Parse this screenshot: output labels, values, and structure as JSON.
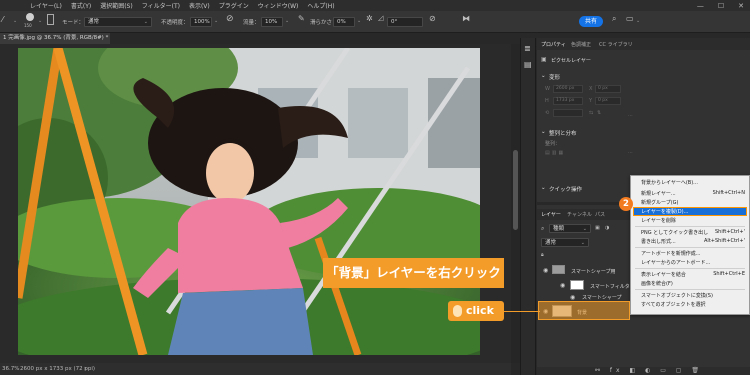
{
  "menubar": {
    "items": [
      "レイヤー(L)",
      "書式(Y)",
      "選択範囲(S)",
      "フィルター(T)",
      "表示(V)",
      "プラグイン",
      "ウィンドウ(W)",
      "ヘルプ(H)"
    ],
    "window_controls": [
      "—",
      "☐",
      "✕"
    ]
  },
  "options": {
    "brush_size": "150",
    "mode_label": "モード：",
    "mode_value": "通常",
    "opacity_label": "不透明度：",
    "opacity_value": "100%",
    "flow_label": "流量：",
    "flow_value": "10%",
    "smooth_label": "滑らかさ：",
    "smooth_value": "0%",
    "angle_value": "0°",
    "share_label": "共有"
  },
  "document": {
    "tab_title": "1 完画像.jpg @ 36.7% (背景, RGB/8#) *",
    "status_zoom": "36.7%",
    "status_info": "2600 px x 1733 px (72 ppi)"
  },
  "properties": {
    "tabs": [
      "プロパティ",
      "色調補正",
      "CC ライブラリ"
    ],
    "pixel_layer_label": "ピクセルレイヤー",
    "transform_label": "変形",
    "w_value": "2600 px",
    "h_value": "1733 px",
    "x_value": "0 px",
    "y_value": "0 px",
    "align_label": "整列と分布",
    "align_sub": "整列：",
    "quick_label": "クイック操作"
  },
  "layers": {
    "tabs": [
      "レイヤー",
      "チャンネル",
      "パス"
    ],
    "search_placeholder": "種類",
    "blend_mode": "通常",
    "rows": [
      {
        "name": "スマートシャープ用"
      },
      {
        "name": "スマートフィルター"
      },
      {
        "name": "スマートシャープ"
      },
      {
        "name": "背景"
      }
    ]
  },
  "context_menu": {
    "items": [
      {
        "label": "背景からレイヤーへ(B)...",
        "shortcut": ""
      },
      {
        "label": "新規レイヤー...",
        "shortcut": "Shift+Ctrl+N"
      },
      {
        "label": "新規グループ(G)",
        "shortcut": ""
      },
      {
        "label": "レイヤーを複製(D)...",
        "shortcut": ""
      },
      {
        "label": "レイヤーを削除",
        "shortcut": ""
      },
      {
        "label": "PNG としてクイック書き出し",
        "shortcut": "Shift+Ctrl+'"
      },
      {
        "label": "書き出し形式...",
        "shortcut": "Alt+Shift+Ctrl+'"
      },
      {
        "label": "アートボードを新規作成...",
        "shortcut": ""
      },
      {
        "label": "レイヤーからのアートボード...",
        "shortcut": ""
      },
      {
        "label": "表示レイヤーを結合",
        "shortcut": "Shift+Ctrl+E"
      },
      {
        "label": "画像を統合(F)",
        "shortcut": ""
      },
      {
        "label": "スマートオブジェクトに変換(S)",
        "shortcut": ""
      },
      {
        "label": "すべてのオブジェクトを選択",
        "shortcut": ""
      }
    ]
  },
  "annotations": {
    "callout_text": "「背景」レイヤーを右クリック",
    "click_text": "click",
    "step_number": "2"
  }
}
